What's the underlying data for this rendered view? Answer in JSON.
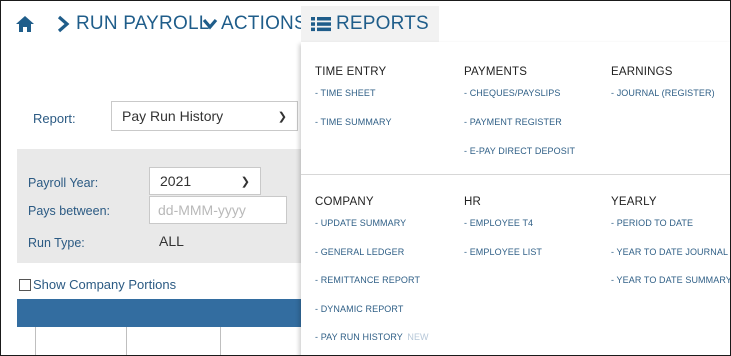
{
  "nav": {
    "run_payroll": "RUN PAYROLL",
    "actions": "ACTIONS",
    "reports": "REPORTS",
    "icons": {
      "home": "home-icon",
      "run": "chevron-right-icon",
      "actions": "chevron-down-icon",
      "reports": "list-icon"
    }
  },
  "form": {
    "report_label": "Report:",
    "report_value": "Pay Run History",
    "payroll_year_label": "Payroll Year:",
    "payroll_year_value": "2021",
    "pays_between_label": "Pays between:",
    "pays_between_placeholder": "dd-MMM-yyyy",
    "run_type_label": "Run Type:",
    "run_type_value": "ALL",
    "show_company_portions": "Show Company Portions"
  },
  "menu": {
    "time_entry": {
      "title": "TIME ENTRY",
      "items": [
        "- TIME SHEET",
        "- TIME SUMMARY"
      ]
    },
    "payments": {
      "title": "PAYMENTS",
      "items": [
        "- CHEQUES/PAYSLIPS",
        "- PAYMENT REGISTER",
        "- E-PAY DIRECT DEPOSIT"
      ]
    },
    "earnings": {
      "title": "EARNINGS",
      "items": [
        "- JOURNAL (REGISTER)"
      ]
    },
    "company": {
      "title": "COMPANY",
      "items": [
        "- UPDATE SUMMARY",
        "- GENERAL LEDGER",
        "- REMITTANCE REPORT",
        "- DYNAMIC REPORT",
        "- PAY RUN HISTORY"
      ],
      "new_badge": "NEW"
    },
    "hr": {
      "title": "HR",
      "items": [
        "- EMPLOYEE T4",
        "- EMPLOYEE LIST"
      ]
    },
    "yearly": {
      "title": "YEARLY",
      "items": [
        "- PERIOD TO DATE",
        "- YEAR TO DATE JOURNAL",
        "- YEAR TO DATE SUMMARY"
      ]
    }
  },
  "colors": {
    "nav_text": "#1f5d8a",
    "table_header": "#336da0",
    "params_bg": "#e9e9e9"
  }
}
